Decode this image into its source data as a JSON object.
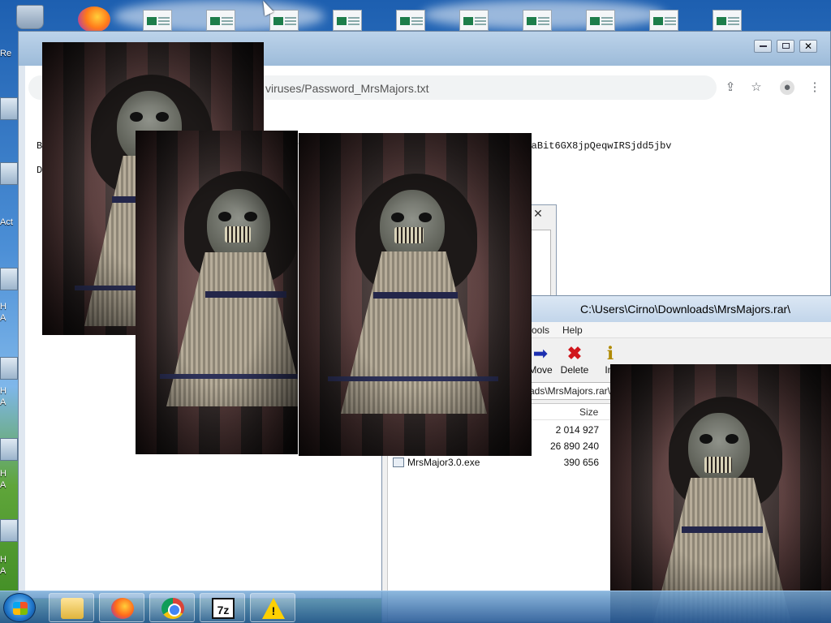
{
  "desktop": {
    "side_labels": [
      "Re",
      "Act",
      "H",
      "A",
      "H",
      "A",
      "H",
      "A",
      "H",
      "A"
    ]
  },
  "browser": {
    "address": "viruses/Password_MrsMajors.txt",
    "doc_line1_prefix": "B",
    "doc_line1": "EULA: https://drive.google.com/file/d/1R3LktjtYaBit6GX8jpQeqwIRSjdd5jbv",
    "doc_line2_prefix": "D",
    "icons": [
      "share-icon",
      "star-icon",
      "profile-icon",
      "menu-icon"
    ]
  },
  "zip": {
    "title": "C:\\Users\\Cirno\\Downloads\\MrsMajors.rar\\",
    "menu": [
      "ools",
      "Help"
    ],
    "buttons": [
      {
        "label": "Move",
        "icon": "arrow-right-icon"
      },
      {
        "label": "Delete",
        "icon": "delete-x-icon"
      },
      {
        "label": "Inf",
        "icon": "info-icon"
      }
    ],
    "path": "ads\\MrsMajors.rar\\",
    "columns": {
      "size": "Size"
    },
    "rows": [
      {
        "name": "",
        "size": "2 014 927"
      },
      {
        "name": "",
        "size": "26 890 240"
      },
      {
        "name": "MrsMajor3.0.exe",
        "size": "390 656"
      }
    ]
  },
  "taskbar": {
    "items": [
      "explorer",
      "firefox",
      "chrome",
      "7-zip",
      "warning"
    ],
    "sevenzip_label": "7z",
    "warning_label": "!"
  },
  "colors": {
    "desktop_blue": "#2f6fb8",
    "taskbar": "#285a96",
    "delete_red": "#d0151b",
    "move_blue": "#1c2fb0"
  }
}
